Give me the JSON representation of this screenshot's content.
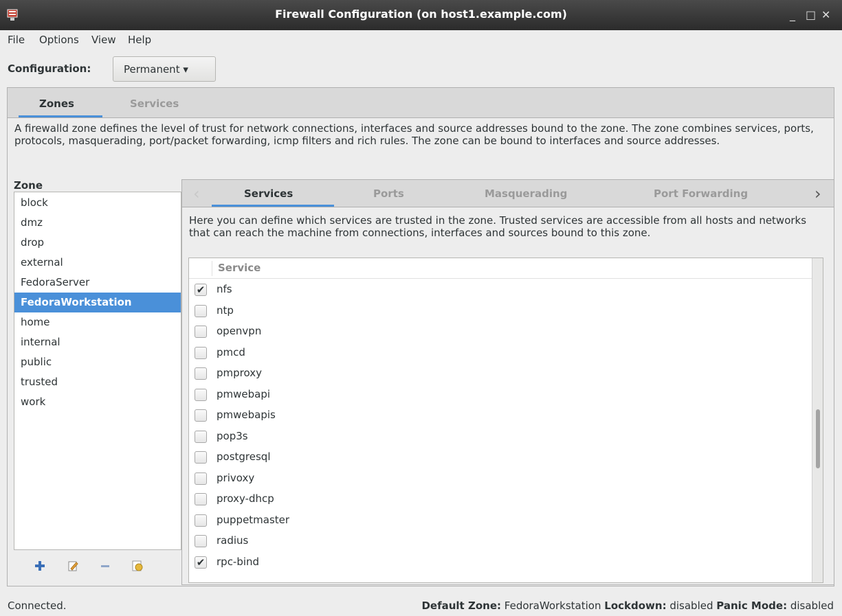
{
  "window": {
    "title": "Firewall Configuration (on host1.example.com)"
  },
  "menu": {
    "file": "File",
    "options": "Options",
    "view": "View",
    "help": "Help"
  },
  "configuration": {
    "label": "Configuration:",
    "value": "Permanent ▾"
  },
  "main_tabs": {
    "zones": "Zones",
    "services": "Services"
  },
  "zone_description": "A firewalld zone defines the level of trust for network connections, interfaces and source addresses bound to the zone. The zone combines services, ports, protocols, masquerading, port/packet forwarding, icmp filters and rich rules. The zone can be bound to interfaces and source addresses.",
  "zones": {
    "label": "Zone",
    "items": [
      "block",
      "dmz",
      "drop",
      "external",
      "FedoraServer",
      "FedoraWorkstation",
      "home",
      "internal",
      "public",
      "trusted",
      "work"
    ],
    "selected": "FedoraWorkstation"
  },
  "inner_tabs": {
    "services": "Services",
    "ports": "Ports",
    "masquerading": "Masquerading",
    "port_forwarding": "Port Forwarding"
  },
  "services_description": "Here you can define which services are trusted in the zone. Trusted services are accessible from all hosts and networks that can reach the machine from connections, interfaces and sources bound to this zone.",
  "service_table": {
    "header": "Service",
    "rows": [
      {
        "name": "nfs",
        "checked": true
      },
      {
        "name": "ntp",
        "checked": false
      },
      {
        "name": "openvpn",
        "checked": false
      },
      {
        "name": "pmcd",
        "checked": false
      },
      {
        "name": "pmproxy",
        "checked": false
      },
      {
        "name": "pmwebapi",
        "checked": false
      },
      {
        "name": "pmwebapis",
        "checked": false
      },
      {
        "name": "pop3s",
        "checked": false
      },
      {
        "name": "postgresql",
        "checked": false
      },
      {
        "name": "privoxy",
        "checked": false
      },
      {
        "name": "proxy-dhcp",
        "checked": false
      },
      {
        "name": "puppetmaster",
        "checked": false
      },
      {
        "name": "radius",
        "checked": false
      },
      {
        "name": "rpc-bind",
        "checked": true
      }
    ]
  },
  "status": {
    "connection": "Connected.",
    "default_zone_label": "Default Zone:",
    "default_zone": "FedoraWorkstation",
    "lockdown_label": "Lockdown:",
    "lockdown": "disabled",
    "panic_label": "Panic Mode:",
    "panic": "disabled"
  },
  "colors": {
    "accent": "#4a90d9",
    "titlebar": "#2b2b2b"
  }
}
